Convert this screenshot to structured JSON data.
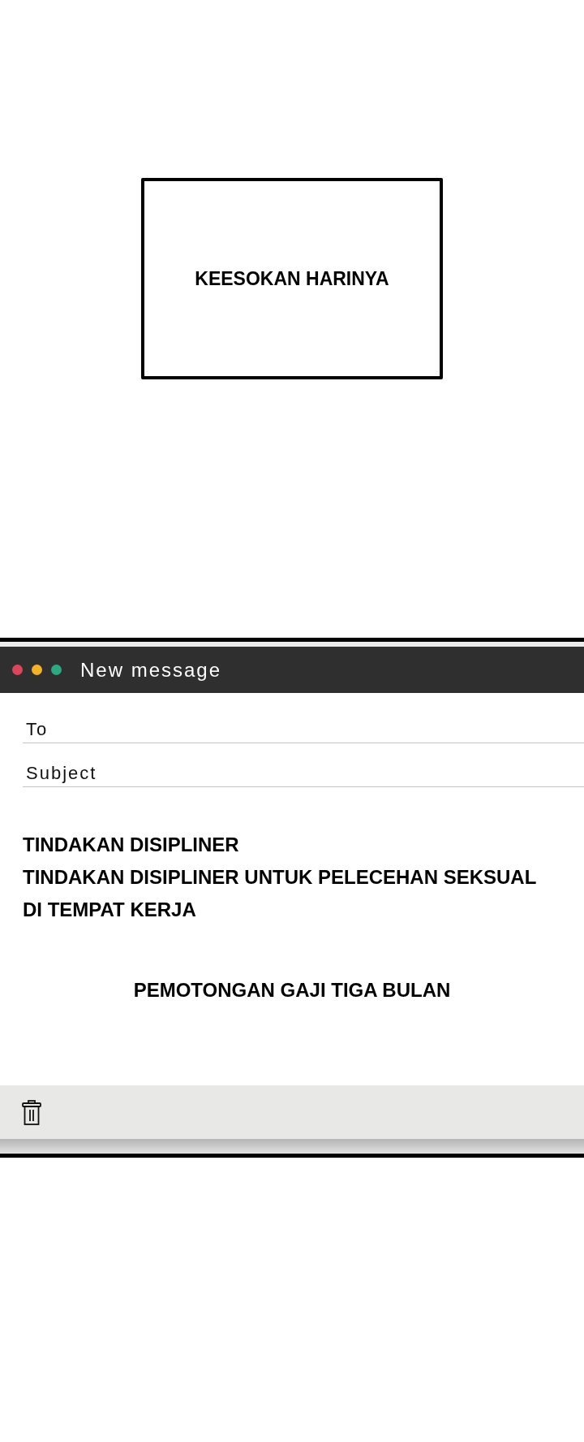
{
  "caption": {
    "text": "KEESOKAN HARINYA"
  },
  "window": {
    "title": "New message",
    "controls": [
      {
        "color": "#e0445a"
      },
      {
        "color": "#f5b323"
      },
      {
        "color": "#2aaa80"
      }
    ]
  },
  "fields": [
    {
      "label": "To"
    },
    {
      "label": "Subject"
    }
  ],
  "body": {
    "heading": "TINDAKAN DISIPLINER",
    "paragraph": "TINDAKAN DISIPLINER UNTUK PELECEHAN SEKSUAL DI TEMPAT KERJA",
    "note": "PEMOTONGAN GAJI TIGA BULAN"
  },
  "toolbar": {
    "buttons": [
      {
        "kind": "trash"
      }
    ]
  }
}
